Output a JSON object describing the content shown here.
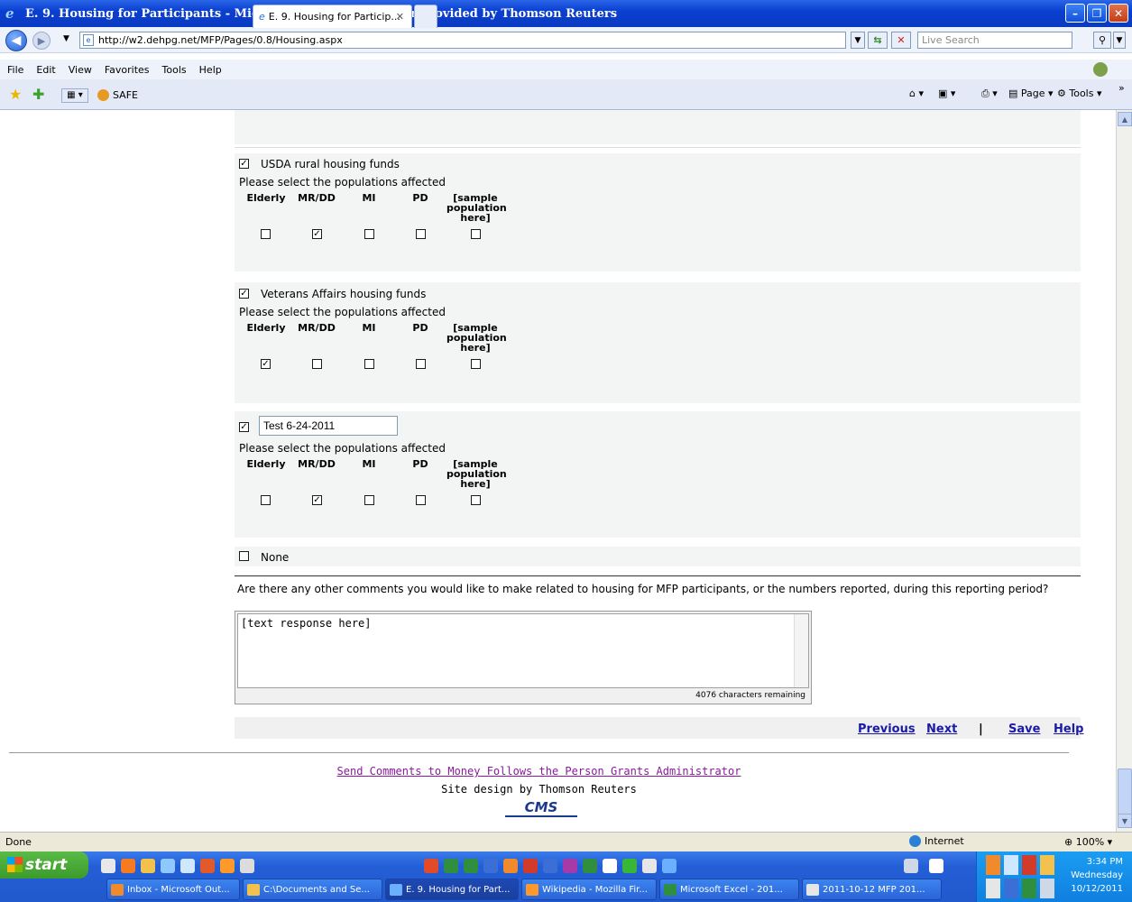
{
  "window": {
    "title": "E. 9. Housing for Participants - Microsoft Internet Explorer provided by Thomson Reuters",
    "url": "http://w2.dehpg.net/MFP/Pages/0.8/Housing.aspx",
    "search_placeholder": "Live Search",
    "min": "–",
    "max": "❐",
    "close": "✕"
  },
  "menu": [
    "File",
    "Edit",
    "View",
    "Favorites",
    "Tools",
    "Help"
  ],
  "tabs": {
    "safe": "SAFE",
    "active": "E. 9. Housing for Particip...",
    "close": "✕"
  },
  "commandbar": {
    "page": "Page",
    "tools": "Tools"
  },
  "form": {
    "select_populations_label": "Please select the populations affected",
    "population_headers": [
      "Elderly",
      "MR/DD",
      "MI",
      "PD",
      "[sample population here]"
    ],
    "sources": [
      {
        "label": "USDA rural housing funds",
        "checked": true,
        "populations": [
          false,
          true,
          false,
          false,
          false
        ]
      },
      {
        "label": "Veterans Affairs housing funds",
        "checked": true,
        "populations": [
          true,
          false,
          false,
          false,
          false
        ]
      },
      {
        "label": "Test 6-24-2011",
        "checked": true,
        "editable": true,
        "populations": [
          false,
          true,
          false,
          false,
          false
        ]
      }
    ],
    "none_label": "None",
    "none_checked": false,
    "comment_question": "Are there any other comments you would like to make related to housing for MFP participants, or the numbers reported, during this reporting period?",
    "comment_value": "[text response here]",
    "chars_remaining": "4076 characters remaining"
  },
  "nav": {
    "previous": "Previous",
    "next": "Next",
    "separator": "|",
    "save": "Save",
    "help": "Help"
  },
  "footer": {
    "send_comments": "Send Comments to Money Follows the Person Grants Administrator",
    "site_design": "Site design by Thomson Reuters",
    "logo": "CMS"
  },
  "status": {
    "text": "Done",
    "zone": "Internet",
    "zoom": "100%"
  },
  "taskbar": {
    "start": "start",
    "items": [
      "Inbox - Microsoft Out...",
      "C:\\Documents and Se...",
      "E. 9. Housing for Part...",
      "Wikipedia - Mozilla Fir...",
      "Microsoft Excel - 201...",
      "2011-10-12 MFP 201..."
    ],
    "time": "3:34 PM",
    "day": "Wednesday",
    "date": "10/12/2011"
  }
}
